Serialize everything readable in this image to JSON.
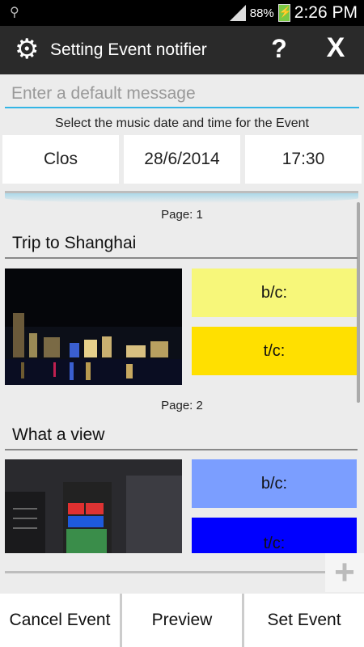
{
  "status_bar": {
    "battery": "88%",
    "time": "2:26 PM"
  },
  "action_bar": {
    "title": "Setting Event notifier",
    "help_label": "?",
    "close_label": "X"
  },
  "message": {
    "placeholder": "Enter a default message"
  },
  "caption": "Select the music date and time for the Event",
  "pickers": {
    "music": "Clos",
    "date": "28/6/2014",
    "time": "17:30"
  },
  "pages": [
    {
      "label": "Page: 1",
      "title": "Trip to Shanghai",
      "bc_label": "b/c:",
      "tc_label": "t/c:",
      "bc_color": "#f7f77a",
      "tc_color": "#ffe000"
    },
    {
      "label": "Page: 2",
      "title": "What a view",
      "bc_label": "b/c:",
      "tc_label": "t/c:",
      "bc_color": "#7b9eff",
      "tc_color": "#0000ff"
    }
  ],
  "add_label": "+",
  "bottom_buttons": {
    "cancel": "Cancel Event",
    "preview": "Preview",
    "set": "Set Event"
  },
  "colors": {
    "accent": "#33b5e5",
    "actionbar": "#2a2a2a"
  }
}
